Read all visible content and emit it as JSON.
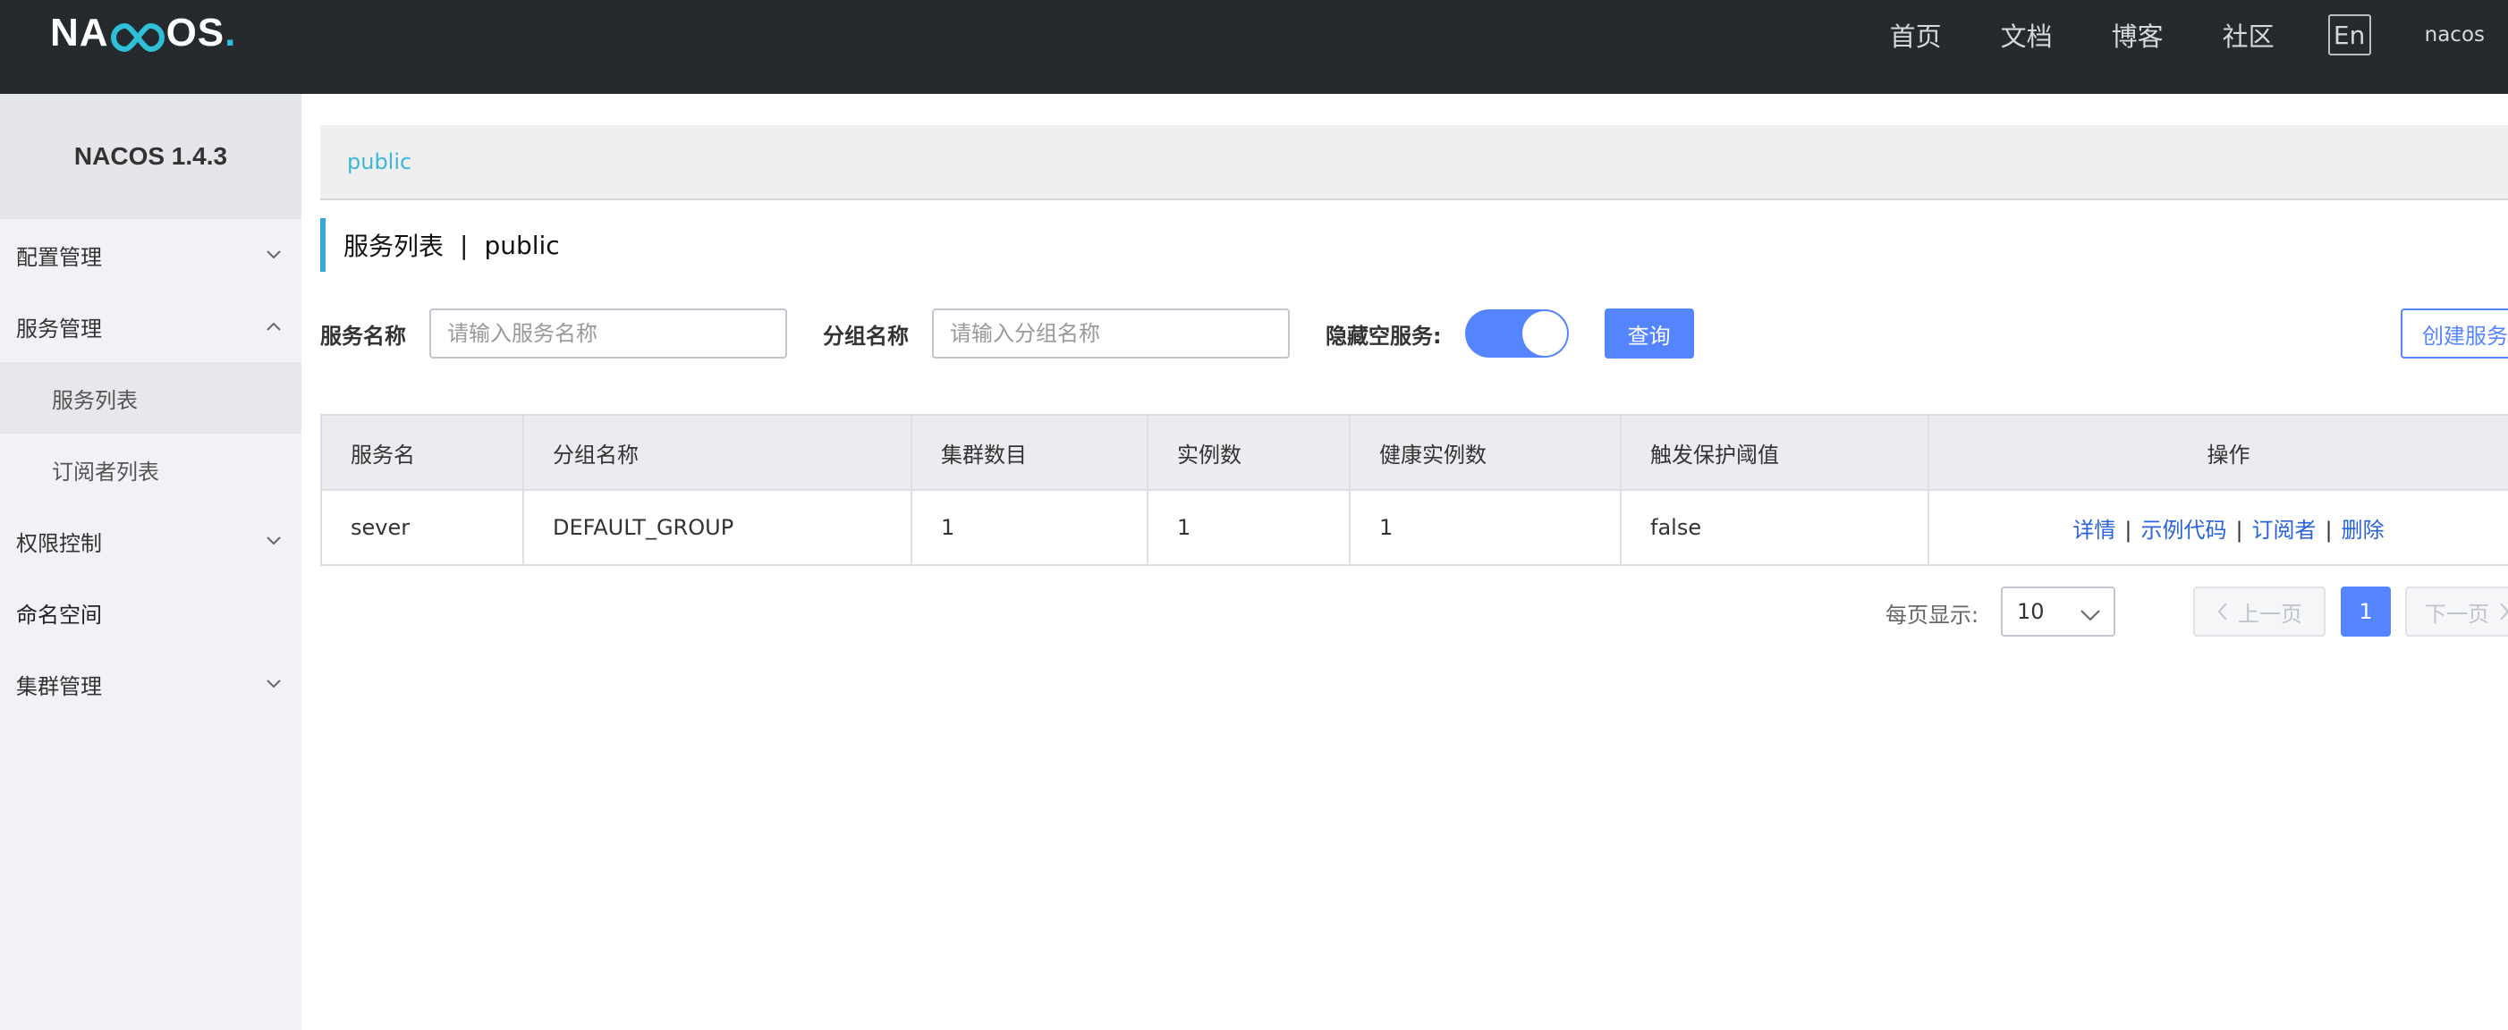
{
  "header": {
    "logo_left": "NA",
    "logo_right": "OS",
    "logo_dot": ".",
    "nav": [
      "首页",
      "文档",
      "博客",
      "社区"
    ],
    "lang": "En",
    "user": "nacos"
  },
  "sidebar": {
    "version": "NACOS 1.4.3",
    "items": [
      {
        "label": "配置管理",
        "expanded": false
      },
      {
        "label": "服务管理",
        "expanded": true
      },
      {
        "label": "服务列表",
        "active": true
      },
      {
        "label": "订阅者列表"
      },
      {
        "label": "权限控制",
        "expanded": false
      },
      {
        "label": "命名空间"
      },
      {
        "label": "集群管理",
        "expanded": false
      }
    ]
  },
  "namespace": {
    "current": "public"
  },
  "page": {
    "title": "服务列表",
    "separator": "|",
    "namespace": "public"
  },
  "filters": {
    "service_label": "服务名称",
    "service_placeholder": "请输入服务名称",
    "group_label": "分组名称",
    "group_placeholder": "请输入分组名称",
    "hide_empty_label": "隐藏空服务:",
    "hide_empty_on": true,
    "query_button": "查询",
    "create_button": "创建服务"
  },
  "table": {
    "columns": [
      "服务名",
      "分组名称",
      "集群数目",
      "实例数",
      "健康实例数",
      "触发保护阈值",
      "操作"
    ],
    "rows": [
      {
        "name": "sever",
        "group": "DEFAULT_GROUP",
        "clusters": "1",
        "instances": "1",
        "healthy": "1",
        "threshold": "false",
        "actions": [
          "详情",
          "示例代码",
          "订阅者",
          "删除"
        ]
      }
    ],
    "action_separator": "|"
  },
  "pagination": {
    "page_size_label": "每页显示:",
    "page_size": "10",
    "prev": "上一页",
    "current_page": "1",
    "next": "下一页"
  },
  "colors": {
    "header_bg": "#252a2f",
    "accent": "#5584ff",
    "link": "#2a62d9",
    "namespace_link": "#3fb6d8"
  }
}
